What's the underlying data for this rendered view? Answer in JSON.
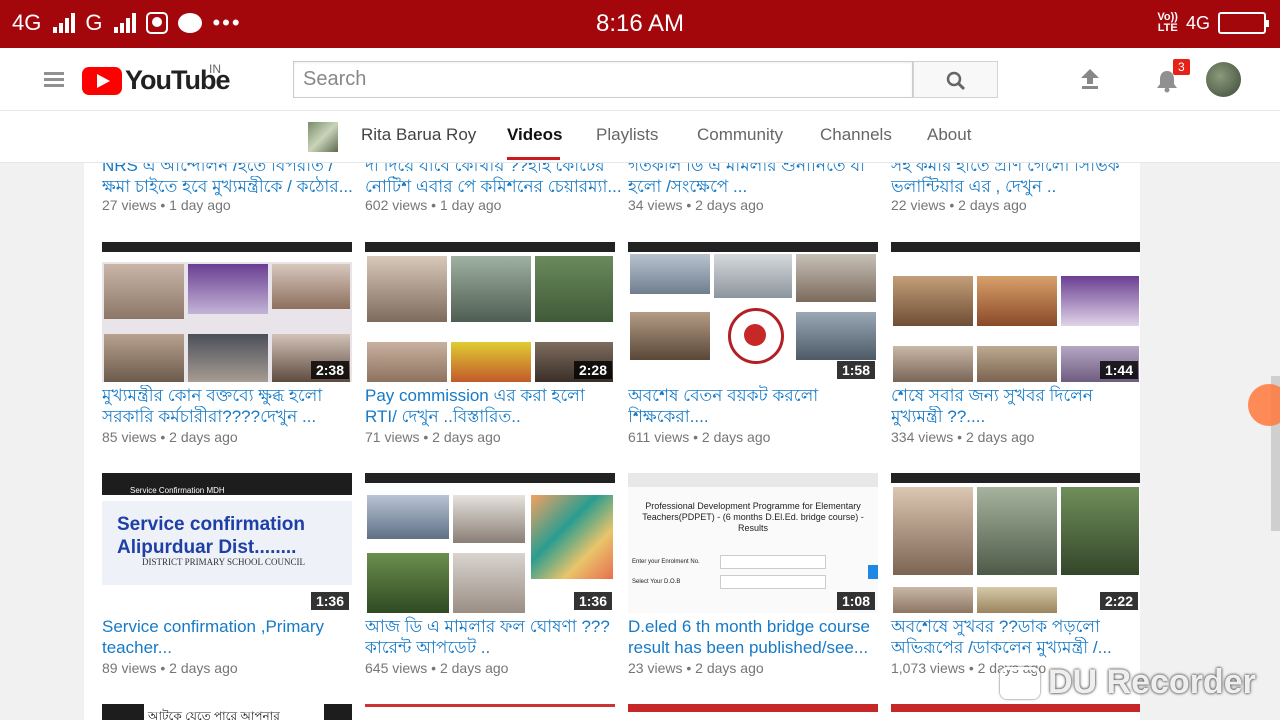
{
  "status_bar": {
    "left_network_1": "4G",
    "left_network_2": "G",
    "time": "8:16 AM",
    "volte_top": "Vo))",
    "volte_bottom": "LTE",
    "right_network": "4G"
  },
  "header": {
    "logo_text": "YouTube",
    "region": "IN",
    "search_placeholder": "Search",
    "notification_count": "3"
  },
  "channel": {
    "name": "Rita Barua Roy",
    "tabs": [
      {
        "label": "Videos",
        "active": true
      },
      {
        "label": "Playlists"
      },
      {
        "label": "Community"
      },
      {
        "label": "Channels"
      },
      {
        "label": "About"
      }
    ]
  },
  "videos": [
    {
      "title_line1": "NRS এ আন্দোলন /হতে বিপরীত /",
      "title_line2": "ক্ষমা চাইতে হবে মুখ্যমন্ত্রীকে / কঠোর...",
      "views": "27 views",
      "age": "1 day ago"
    },
    {
      "title_line1": "দা দিয়ে যাবে কোথায় ??হাই কোর্টের",
      "title_line2": "নোটিশ এবার পে কমিশনের চেয়ারম্যা...",
      "views": "602 views",
      "age": "1 day ago"
    },
    {
      "title_line1": "গতকাল ডি এ মামলার শুনানিতে যা",
      "title_line2": "হলো /সংক্ষেপে ...",
      "views": "34 views",
      "age": "2 days ago"
    },
    {
      "title_line1": "সহ কর্মীর হাতে প্রাণ গেলো সিভিক",
      "title_line2": "ভলান্টিয়ার এর , দেখুন ..",
      "views": "22 views",
      "age": "2 days ago"
    },
    {
      "title_line1": "মুখ্যমন্ত্রীর কোন বক্তব্যে ক্ষুব্ধ হলো",
      "title_line2": "সরকারি কর্মচারীরা????দেখুন ...",
      "views": "85 views",
      "age": "2 days ago",
      "duration": "2:38"
    },
    {
      "title_line1": "Pay commission এর করা হলো",
      "title_line2": "RTI/ দেখুন ..বিস্তারিত..",
      "views": "71 views",
      "age": "2 days ago",
      "duration": "2:28"
    },
    {
      "title_line1": "অবশেষ বেতন বয়কট করলো",
      "title_line2": "শিক্ষকেরা....",
      "views": "611 views",
      "age": "2 days ago",
      "duration": "1:58"
    },
    {
      "title_line1": "শেষে সবার জন্য সুখবর দিলেন",
      "title_line2": "মুখ্যমন্ত্রী ??....",
      "views": "334 views",
      "age": "2 days ago",
      "duration": "1:44"
    },
    {
      "title_line1": "Service confirmation ,Primary",
      "title_line2": "teacher...",
      "views": "89 views",
      "age": "2 days ago",
      "duration": "1:36"
    },
    {
      "title_line1": "আজ ডি এ মামলার ফল ঘোষণা ???",
      "title_line2": "কারেন্ট আপডেট ..",
      "views": "645 views",
      "age": "2 days ago",
      "duration": "1:36"
    },
    {
      "title_line1": "D.eled 6 th month bridge course",
      "title_line2": "result has been published/see...",
      "views": "23 views",
      "age": "2 days ago",
      "duration": "1:08"
    },
    {
      "title_line1": "অবশেষে সুখবর ??ডাক পড়লো",
      "title_line2": "অভিরূপের /ডাকলেন মুখ্যমন্ত্রী /...",
      "views": "1,073 views",
      "age": "2 days ago",
      "duration": "2:22"
    }
  ],
  "thumb_text": {
    "service_header": "Service Confirmation MDH",
    "service_line1": "Service confirmation",
    "service_line2": "Alipurduar Dist........",
    "service_council": "DISTRICT PRIMARY SCHOOL COUNCIL",
    "deled_header": "Professional Development Programme for Elementary Teachers(PDPET) - (6 months D.El.Ed. bridge course) - Results",
    "deled_enrol": "Enter your Enrolment No.",
    "deled_dob": "Select Your D.O.B",
    "bottom_partial": "আটকে যেতে পারে আপনার"
  },
  "watermark": "DU Recorder"
}
